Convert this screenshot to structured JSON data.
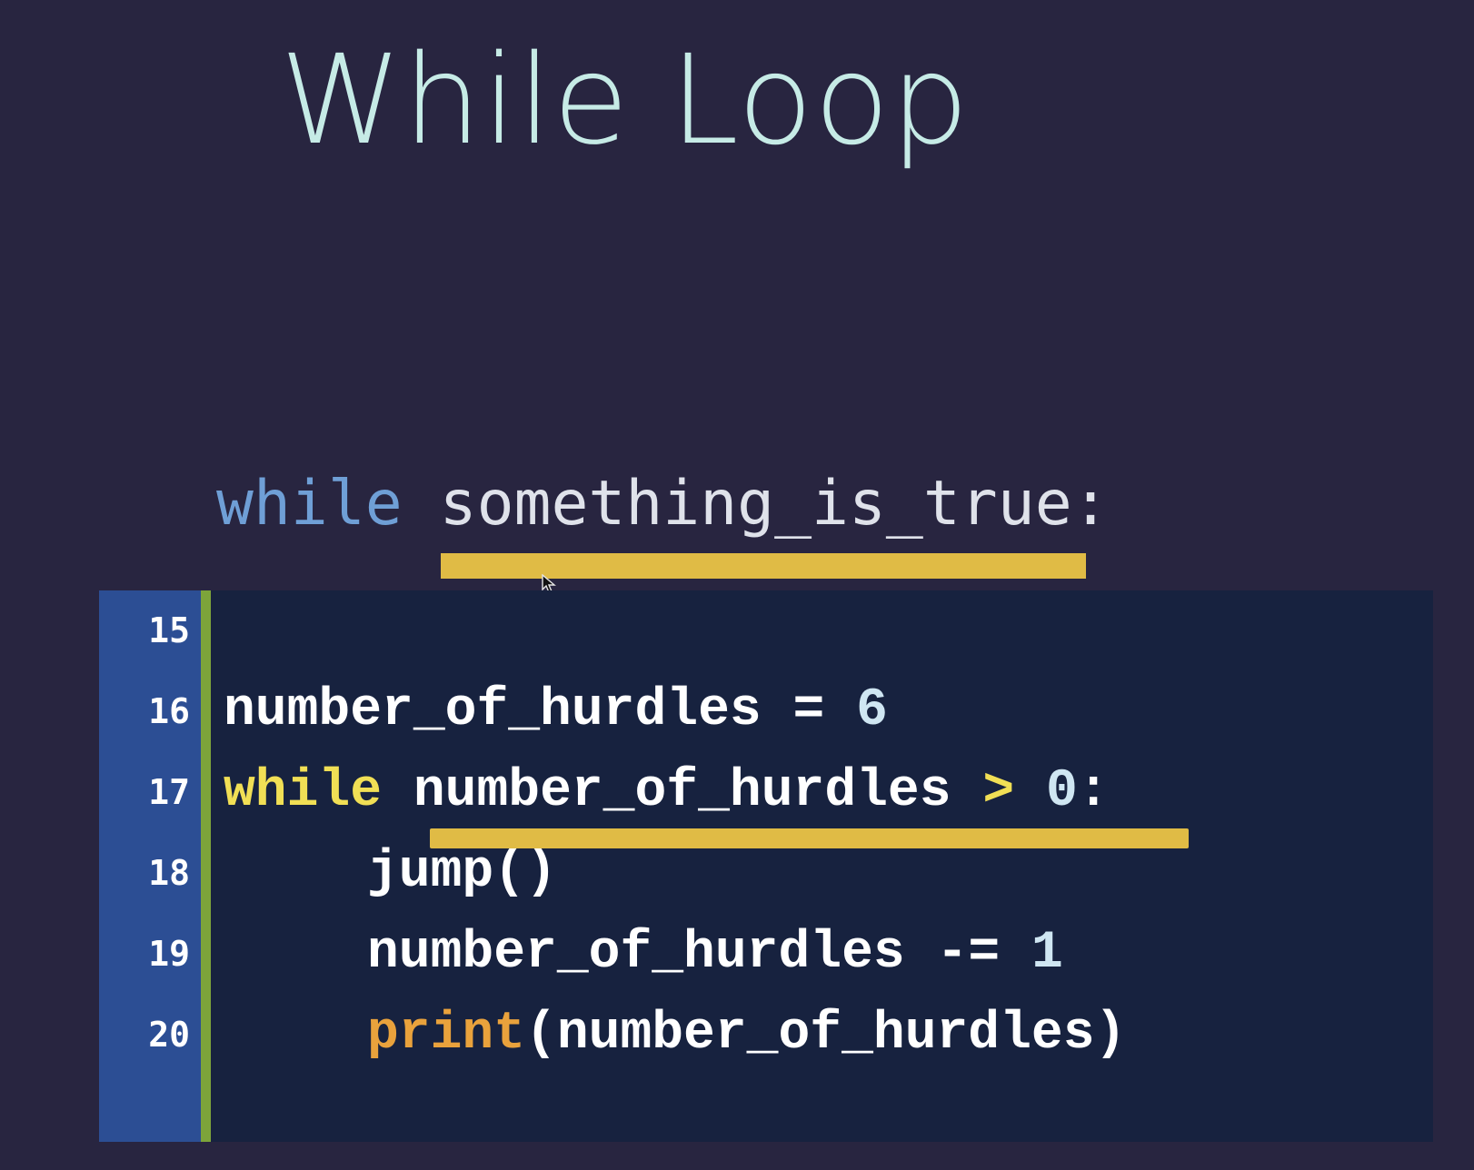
{
  "slide": {
    "title": "While Loop"
  },
  "syntax": {
    "keyword": "while",
    "condition": "something_is_true:"
  },
  "code": {
    "line_numbers": [
      "15",
      "16",
      "17",
      "18",
      "19",
      "20"
    ],
    "line16": {
      "var": "number_of_hurdles",
      "op": " = ",
      "value": "6"
    },
    "line17": {
      "keyword": "while",
      "var": "number_of_hurdles",
      "op": " > ",
      "value": "0",
      "colon": ":"
    },
    "line18": {
      "call": "jump()"
    },
    "line19": {
      "var": "number_of_hurdles",
      "op": " -= ",
      "value": "1"
    },
    "line20": {
      "func": "print",
      "args": "(number_of_hurdles)"
    }
  },
  "colors": {
    "background": "#282540",
    "title": "#c6ebe6",
    "keyword_blue": "#6f9fd6",
    "highlight_yellow": "#e0bb45",
    "code_background": "#17223f",
    "gutter": "#2c4e94",
    "gutter_border": "#7da43a",
    "keyword_yellow": "#f1df55",
    "function_orange": "#e9a23c"
  },
  "icons": {
    "pointer": "mouse-cursor-icon"
  }
}
